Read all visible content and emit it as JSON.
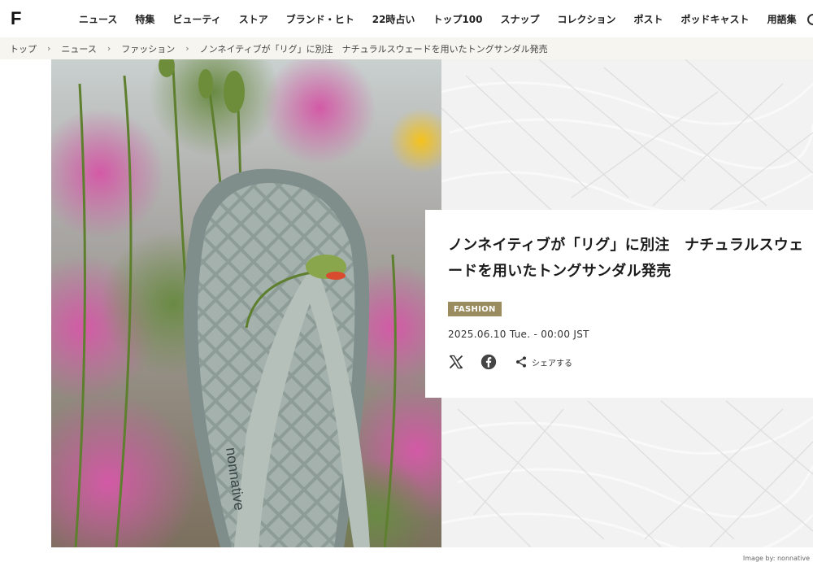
{
  "header": {
    "logo": "F",
    "nav": [
      "ニュース",
      "特集",
      "ビューティ",
      "ストア",
      "ブランド・ヒト",
      "22時占い",
      "トップ100",
      "スナップ",
      "コレクション",
      "ポスト",
      "ポッドキャスト",
      "用語集"
    ]
  },
  "breadcrumb": [
    "トップ",
    "ニュース",
    "ファッション",
    "ノンネイティブが「リグ」に別注　ナチュラルスウェードを用いたトングサンダル発売"
  ],
  "article": {
    "title": "ノンネイティブが「リグ」に別注　ナチュラルスウェードを用いたトングサンダル発売",
    "category": "FASHION",
    "date": "2025.06.10 Tue. - 00:00 JST",
    "share_label": "シェアする",
    "image_credit": "Image by: nonnative",
    "strap_text": "nonnative"
  },
  "icons": {
    "x": "x-logo-icon",
    "facebook": "facebook-icon",
    "share": "share-icon",
    "chevron": "chevron-right-icon",
    "search": "search-icon"
  },
  "colors": {
    "badge": "#9b8c5f",
    "breadcrumb_bg": "#f7f5ef",
    "hero_bg": "#f2f2f2"
  }
}
